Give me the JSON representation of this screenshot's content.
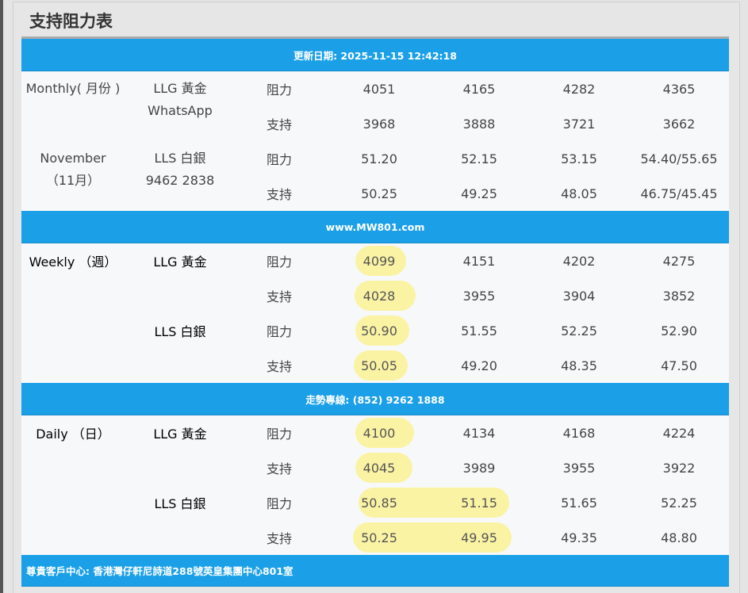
{
  "title": "支持阻力表",
  "banners": {
    "date": "更新日期: 2025-11-15 12:42:18",
    "site": "www.MW801.com",
    "hotline": "走勢專線: (852) 9262 1888",
    "address": "尊貴客戶中心: 香港灣仔軒尼詩道288號英皇集團中心801室"
  },
  "monthly": {
    "period": [
      "Monthly( 月份 )",
      "",
      "November",
      "（11月）"
    ],
    "metal_gold": [
      "LLG 黃金",
      "WhatsApp"
    ],
    "metal_silver": [
      "LLS 白銀",
      "9462 2838"
    ],
    "rows": [
      {
        "type": "阻力",
        "v": [
          "4051",
          "4165",
          "4282",
          "4365"
        ]
      },
      {
        "type": "支持",
        "v": [
          "3968",
          "3888",
          "3721",
          "3662"
        ]
      },
      {
        "type": "阻力",
        "v": [
          "51.20",
          "52.15",
          "53.15",
          "54.40/55.65"
        ]
      },
      {
        "type": "支持",
        "v": [
          "50.25",
          "49.25",
          "48.05",
          "46.75/45.45"
        ]
      }
    ]
  },
  "weekly": {
    "period": "Weekly （週）",
    "metal_gold": "LLG 黃金",
    "metal_silver": "LLS 白銀",
    "rows": [
      {
        "type": "阻力",
        "v": [
          "4099",
          "4151",
          "4202",
          "4275"
        ]
      },
      {
        "type": "支持",
        "v": [
          "4028",
          "3955",
          "3904",
          "3852"
        ]
      },
      {
        "type": "阻力",
        "v": [
          "50.90",
          "51.55",
          "52.25",
          "52.90"
        ]
      },
      {
        "type": "支持",
        "v": [
          "50.05",
          "49.20",
          "48.35",
          "47.50"
        ]
      }
    ]
  },
  "daily": {
    "period": "Daily （日）",
    "metal_gold": "LLG 黃金",
    "metal_silver": "LLS 白銀",
    "rows": [
      {
        "type": "阻力",
        "v": [
          "4100",
          "4134",
          "4168",
          "4224"
        ]
      },
      {
        "type": "支持",
        "v": [
          "4045",
          "3989",
          "3955",
          "3922"
        ]
      },
      {
        "type": "阻力",
        "v": [
          "50.85",
          "51.15",
          "51.65",
          "52.25"
        ]
      },
      {
        "type": "支持",
        "v": [
          "50.25",
          "49.95",
          "49.35",
          "48.80"
        ]
      }
    ]
  },
  "colors": {
    "banner": "#1ba0e8",
    "highlight": "#faf3a4",
    "row_bg": "#f7f8fa"
  }
}
